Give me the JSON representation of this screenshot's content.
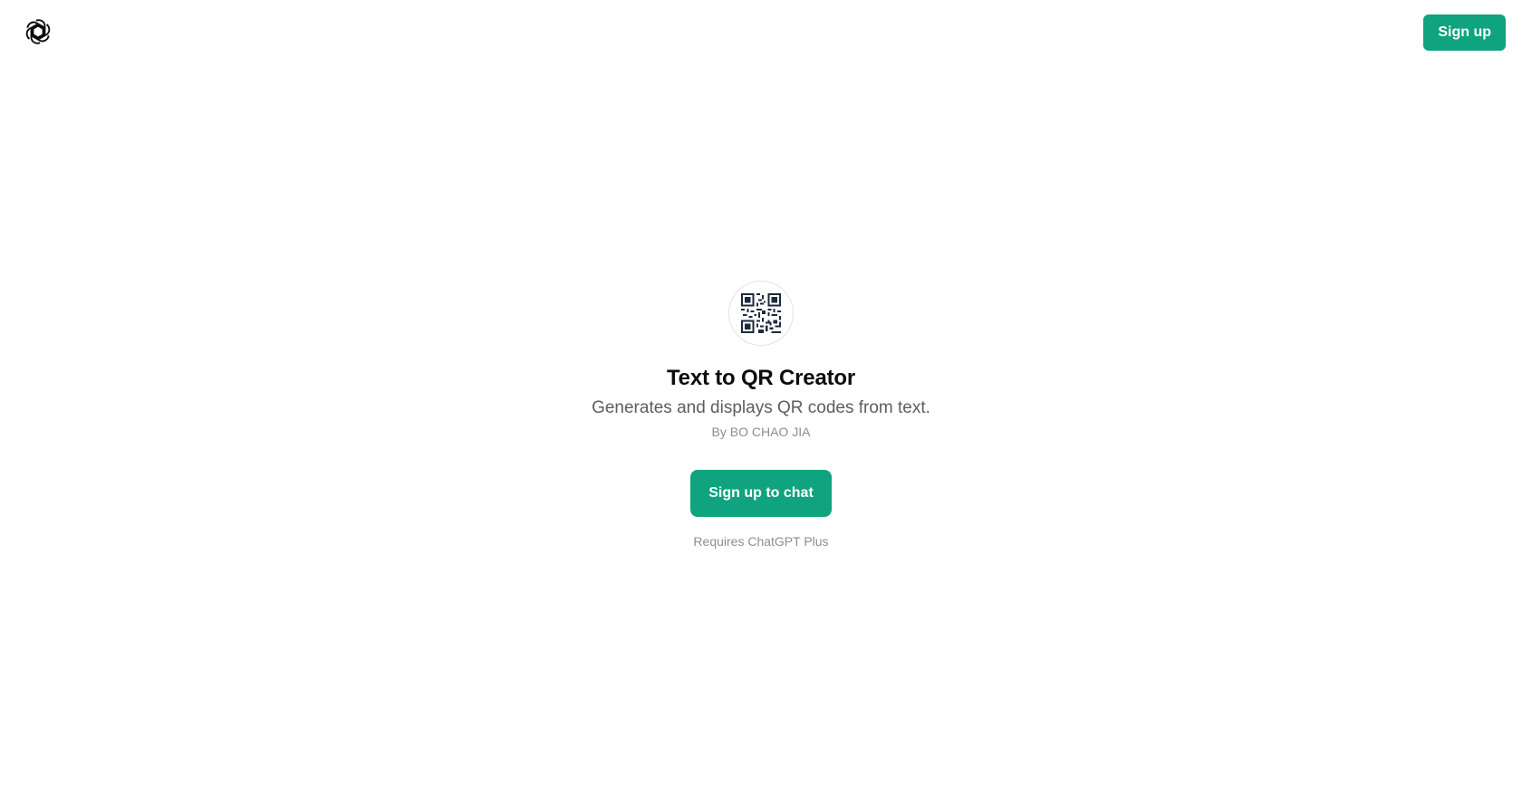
{
  "header": {
    "logo_icon": "openai-logo-icon",
    "signup_label": "Sign up"
  },
  "gpt": {
    "avatar_icon": "qr-code-icon",
    "title": "Text to QR Creator",
    "description": "Generates and displays QR codes from text.",
    "author": "By BO CHAO JIA",
    "cta_label": "Sign up to chat",
    "requirement": "Requires ChatGPT Plus"
  },
  "colors": {
    "accent": "#10a37f",
    "text_primary": "#0d0d0d",
    "text_secondary": "#5d5d5d",
    "text_muted": "#8e8e8e",
    "qr_dark": "#1e2a3a"
  }
}
